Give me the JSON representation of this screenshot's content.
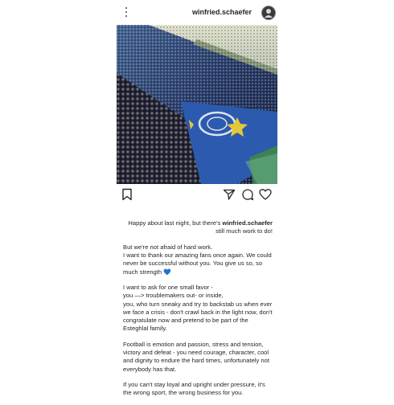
{
  "header": {
    "username": "winfried.schaefer"
  },
  "post": {
    "image_icon": "stadium-photo",
    "actions": {
      "save_icon": "bookmark-icon",
      "share_icon": "paper-plane-icon",
      "comment_icon": "comment-bubble-icon",
      "like_icon": "heart-icon"
    }
  },
  "caption": {
    "intro": "Happy about last night, but there's",
    "username": "winfried.schaefer",
    "intro_tail": "still much work to do!",
    "paragraph1": "But we're not afraid of hard work.\nI want to thank our amazing fans once again. We could never be successful without you. You give us so, so much strength",
    "emoji": "💙",
    "paragraph2": "I want to ask for one small favor -\nyou —> troublemakers out- or inside,\nyou, who turn sneaky and try to backstab us when ever we face a crisis - don't crawl back in the light now, don't congratulate now and pretend to be part of the Esteghlal family.",
    "paragraph3": "Football is emotion and passion, stress and tension, victory and defeat - you need courage, character, cool and dignity to endure the hard times, unfortunately not everybody has that.",
    "paragraph4": "If you can't stay loyal and upright under pressure, it's the wrong sport, the wrong business for you."
  },
  "colors": {
    "text": "#262626",
    "accent_heart": "#3b8fe0"
  }
}
